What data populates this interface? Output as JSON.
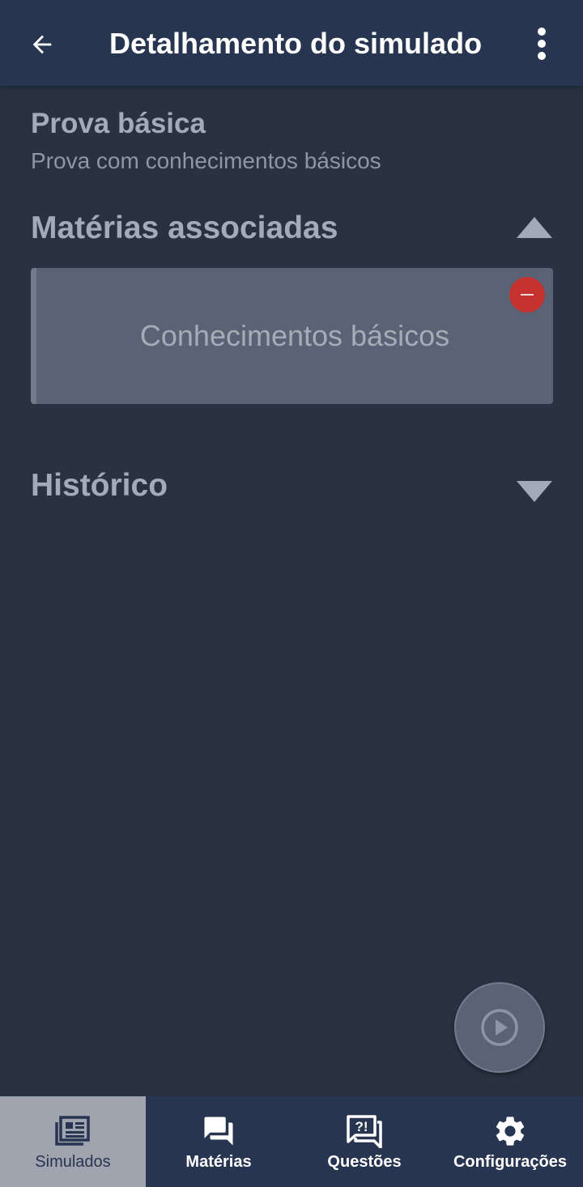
{
  "topbar": {
    "back_icon": "arrow-left-icon",
    "title": "Detalhamento do simulado",
    "menu_icon": "more-vertical-icon"
  },
  "exam": {
    "title": "Prova básica",
    "subtitle": "Prova com conhecimentos básicos"
  },
  "sections": {
    "materias": {
      "title": "Matérias associadas",
      "expanded": true,
      "items": [
        {
          "label": "Conhecimentos básicos",
          "remove_icon": "remove-circle-icon"
        }
      ]
    },
    "historico": {
      "title": "Histórico",
      "expanded": false
    }
  },
  "fab": {
    "icon": "play-circle-icon"
  },
  "bottom_nav": {
    "items": [
      {
        "label": "Simulados",
        "icon": "newspaper-icon",
        "active": true
      },
      {
        "label": "Matérias",
        "icon": "forum-icon",
        "active": false
      },
      {
        "label": "Questões",
        "icon": "questions-icon",
        "active": false
      },
      {
        "label": "Configurações",
        "icon": "gear-icon",
        "active": false
      }
    ]
  },
  "colors": {
    "appbar": "#283550",
    "background": "#293241",
    "card": "#5a6376",
    "danger": "#c4332f",
    "nav_active": "#9fa4ae"
  }
}
